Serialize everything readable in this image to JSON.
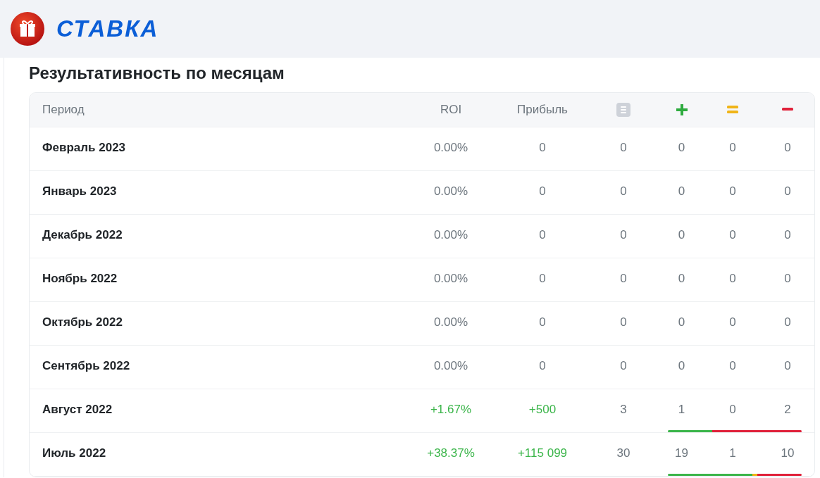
{
  "logo": {
    "text": "СТАВКА"
  },
  "title": "Результативность по месяцам",
  "table": {
    "columns": [
      "Период",
      "ROI",
      "Прибыль"
    ],
    "rows": [
      {
        "period": "Февраль 2023",
        "roi": "0.00%",
        "profit": "0",
        "total": "0",
        "wins": "0",
        "draws": "0",
        "losses": "0",
        "positive": false
      },
      {
        "period": "Январь 2023",
        "roi": "0.00%",
        "profit": "0",
        "total": "0",
        "wins": "0",
        "draws": "0",
        "losses": "0",
        "positive": false
      },
      {
        "period": "Декабрь 2022",
        "roi": "0.00%",
        "profit": "0",
        "total": "0",
        "wins": "0",
        "draws": "0",
        "losses": "0",
        "positive": false
      },
      {
        "period": "Ноябрь 2022",
        "roi": "0.00%",
        "profit": "0",
        "total": "0",
        "wins": "0",
        "draws": "0",
        "losses": "0",
        "positive": false
      },
      {
        "period": "Октябрь 2022",
        "roi": "0.00%",
        "profit": "0",
        "total": "0",
        "wins": "0",
        "draws": "0",
        "losses": "0",
        "positive": false
      },
      {
        "period": "Сентябрь 2022",
        "roi": "0.00%",
        "profit": "0",
        "total": "0",
        "wins": "0",
        "draws": "0",
        "losses": "0",
        "positive": false
      },
      {
        "period": "Август 2022",
        "roi": "+1.67%",
        "profit": "+500",
        "total": "3",
        "wins": "1",
        "draws": "0",
        "losses": "2",
        "positive": true
      },
      {
        "period": "Июль 2022",
        "roi": "+38.37%",
        "profit": "+115 099",
        "total": "30",
        "wins": "19",
        "draws": "1",
        "losses": "10",
        "positive": true
      }
    ]
  }
}
